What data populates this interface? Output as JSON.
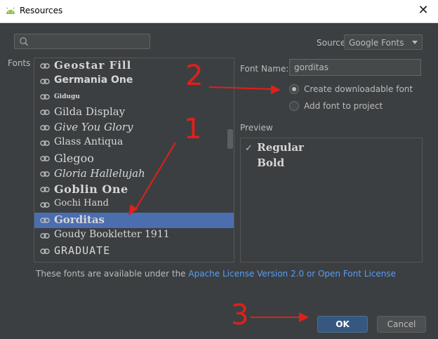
{
  "window": {
    "title": "Resources",
    "close_glyph": "✕"
  },
  "search": {
    "placeholder": ""
  },
  "source": {
    "label": "Source",
    "value": "Google Fonts"
  },
  "fonts": {
    "label": "Fonts",
    "items": [
      {
        "name": "Geostar Fill"
      },
      {
        "name": "Germania One"
      },
      {
        "name": "Gidugu"
      },
      {
        "name": "Gilda Display"
      },
      {
        "name": "Give You Glory"
      },
      {
        "name": "Glass Antiqua"
      },
      {
        "name": "Glegoo"
      },
      {
        "name": "Gloria Hallelujah"
      },
      {
        "name": "Goblin One"
      },
      {
        "name": "Gochi Hand"
      },
      {
        "name": "Gorditas",
        "selected": true
      },
      {
        "name": "Goudy Bookletter 1911"
      },
      {
        "name": "GRADUATE"
      }
    ]
  },
  "font_name": {
    "label": "Font Name:",
    "value": "gorditas"
  },
  "options": {
    "downloadable": "Create downloadable font",
    "add_to_project": "Add font to project",
    "selected": "downloadable"
  },
  "preview": {
    "label": "Preview",
    "rows": [
      {
        "text": "Regular",
        "checked": true
      },
      {
        "text": "Bold",
        "checked": false
      }
    ]
  },
  "license": {
    "prefix": "These fonts are available under the ",
    "link": "Apache License Version 2.0 or Open Font License"
  },
  "buttons": {
    "ok": "OK",
    "cancel": "Cancel"
  },
  "annotations": {
    "one": "1",
    "two": "2",
    "three": "3",
    "color": "#e0201a"
  },
  "icons": {
    "app": "android-icon",
    "search": "search-icon",
    "link": "link-icon",
    "dropdown": "chevron-down-icon",
    "check": "checkmark-icon"
  }
}
